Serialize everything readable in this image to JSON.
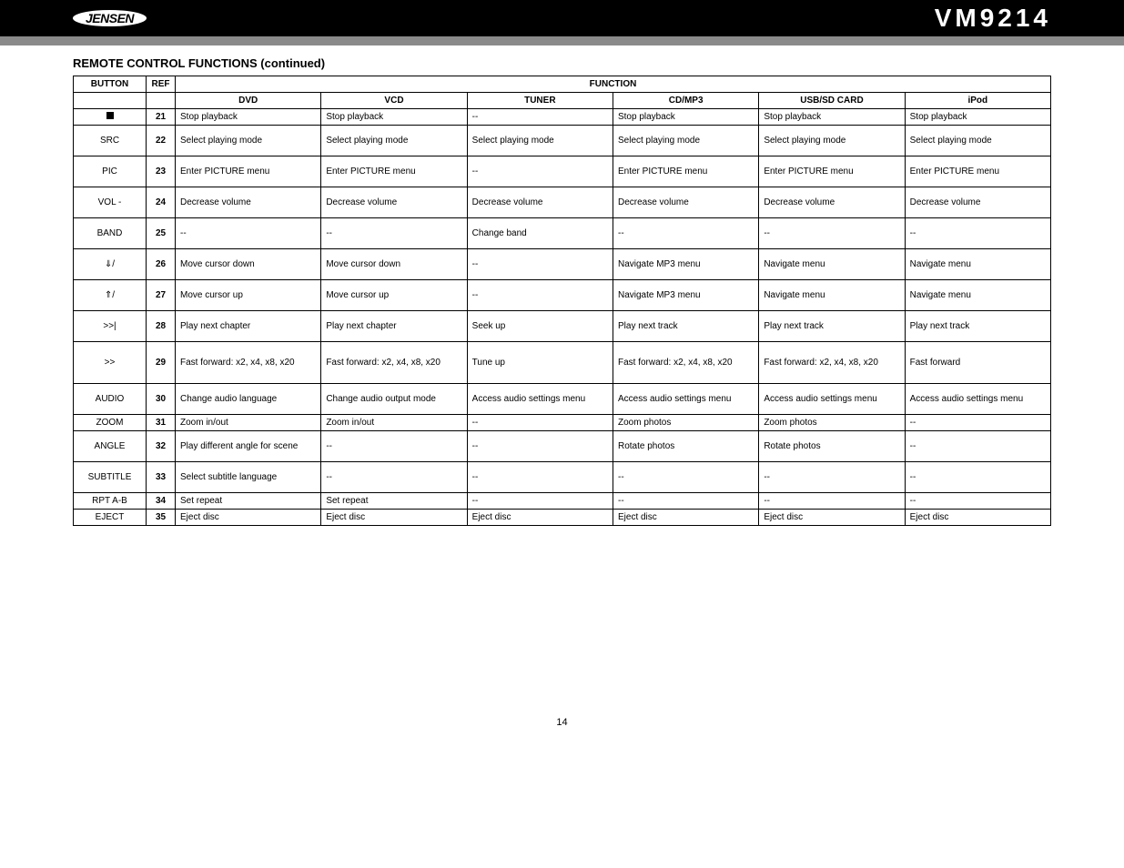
{
  "header": {
    "logo_text": "JENSEN",
    "model": "VM9214"
  },
  "title": "REMOTE CONTROL FUNCTIONS (continued)",
  "table": {
    "groupheaders": {
      "button": "BUTTON",
      "ref": "REF",
      "function": "FUNCTION"
    },
    "modes": [
      "DVD",
      "VCD",
      "TUNER",
      "CD/MP3",
      "USB/SD CARD",
      "iPod"
    ],
    "rows": [
      {
        "btn": "■",
        "btntype": "icon-stop",
        "ref": "21",
        "cells": [
          "Stop playback",
          "Stop playback",
          "--",
          "Stop playback",
          "Stop playback",
          "Stop playback"
        ],
        "rowclass": ""
      },
      {
        "btn": "SRC",
        "ref": "22",
        "cells": [
          "Select playing mode",
          "Select playing mode",
          "Select playing mode",
          "Select playing mode",
          "Select playing mode",
          "Select playing mode"
        ],
        "rowclass": "tall"
      },
      {
        "btn": "PIC",
        "ref": "23",
        "cells": [
          "Enter PICTURE menu",
          "Enter PICTURE menu",
          "--",
          "Enter PICTURE menu",
          "Enter PICTURE menu",
          "Enter PICTURE menu"
        ],
        "rowclass": "tall"
      },
      {
        "btn": "VOL -",
        "ref": "24",
        "cells": [
          "Decrease volume",
          "Decrease volume",
          "Decrease volume",
          "Decrease volume",
          "Decrease volume",
          "Decrease volume"
        ],
        "rowclass": "tall"
      },
      {
        "btn": "BAND",
        "ref": "25",
        "cells": [
          "--",
          "--",
          "Change band",
          "--",
          "--",
          "--"
        ],
        "rowclass": "tall"
      },
      {
        "btn": "/",
        "btntype": "icon-down",
        "ref": "26",
        "cells": [
          "Move cursor down",
          "Move cursor down",
          "--",
          "Navigate MP3 menu",
          "Navigate menu",
          "Navigate menu"
        ],
        "rowclass": "tall"
      },
      {
        "btn": "/",
        "btntype": "icon-up",
        "ref": "27",
        "cells": [
          "Move cursor up",
          "Move cursor up",
          "--",
          "Navigate MP3 menu",
          "Navigate menu",
          "Navigate menu"
        ],
        "rowclass": "tall"
      },
      {
        "btn": ">>|",
        "ref": "28",
        "cells": [
          "Play next chapter",
          "Play next chapter",
          "Seek up",
          "Play next track",
          "Play next track",
          "Play next track"
        ],
        "rowclass": "tall"
      },
      {
        "btn": ">>",
        "ref": "29",
        "cells": [
          "Fast forward: x2, x4, x8, x20",
          "Fast forward: x2, x4, x8, x20",
          "Tune up",
          "Fast forward: x2, x4, x8, x20",
          "Fast forward: x2, x4, x8, x20",
          "Fast forward"
        ],
        "rowclass": "taller"
      },
      {
        "btn": "AUDIO",
        "ref": "30",
        "cells": [
          "Change audio language",
          "Change audio output mode",
          "Access audio settings menu",
          "Access audio settings menu",
          "Access audio settings menu",
          "Access audio settings menu"
        ],
        "rowclass": "tall"
      },
      {
        "btn": "ZOOM",
        "ref": "31",
        "cells": [
          "Zoom in/out",
          "Zoom in/out",
          "--",
          "Zoom photos",
          "Zoom photos",
          "--"
        ],
        "rowclass": ""
      },
      {
        "btn": "ANGLE",
        "ref": "32",
        "cells": [
          "Play different angle for scene",
          "--",
          "--",
          "Rotate photos",
          "Rotate photos",
          "--"
        ],
        "rowclass": "tall"
      },
      {
        "btn": "SUBTITLE",
        "ref": "33",
        "cells": [
          "Select subtitle language",
          "--",
          "--",
          "--",
          "--",
          "--"
        ],
        "rowclass": "tall"
      },
      {
        "btn": "RPT A-B",
        "ref": "34",
        "cells": [
          "Set repeat",
          "Set repeat",
          "--",
          "--",
          "--",
          "--"
        ],
        "rowclass": ""
      },
      {
        "btn": "EJECT",
        "ref": "35",
        "cells": [
          "Eject disc",
          "Eject disc",
          "Eject disc",
          "Eject disc",
          "Eject disc",
          "Eject disc"
        ],
        "rowclass": ""
      }
    ]
  },
  "pagenum": "14"
}
